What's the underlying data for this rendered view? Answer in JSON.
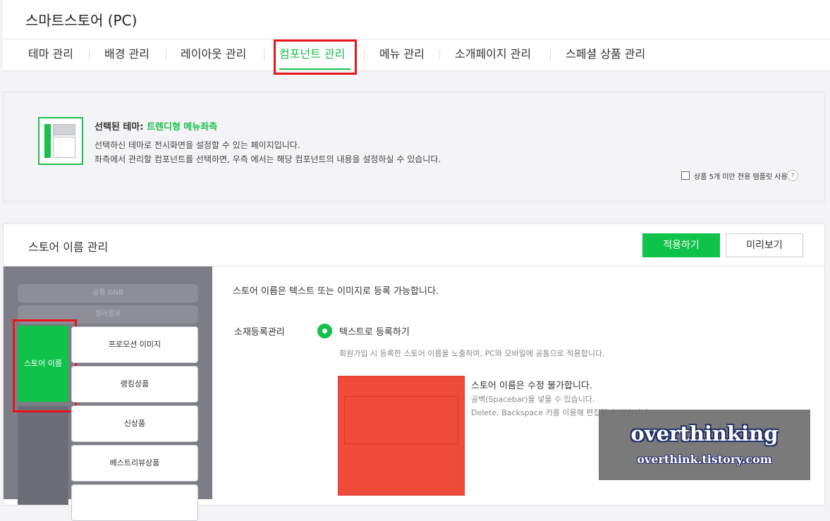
{
  "header": {
    "title": "스마트스토어 (PC)"
  },
  "tabs": [
    {
      "label": "테마 관리",
      "active": false
    },
    {
      "label": "배경 관리",
      "active": false
    },
    {
      "label": "레이아웃 관리",
      "active": false
    },
    {
      "label": "컴포넌트 관리",
      "active": true
    },
    {
      "label": "메뉴 관리",
      "active": false
    },
    {
      "label": "소개페이지 관리",
      "active": false
    },
    {
      "label": "스페셜 상품 관리",
      "active": false
    }
  ],
  "theme": {
    "selected_label": "선택된 테마:",
    "selected_name": "트렌디형 메뉴좌측",
    "desc1": "선택하신 테마로 전시화면을 설정할 수 있는 페이지입니다.",
    "desc2": "좌측에서 관리할 컴포넌트를 선택하면, 우측 에서는 해당 컴포넌트의 내용을 설정하실 수 있습니다.",
    "template_checkbox_label": "상품 5개 미만 전용 템플릿 사용",
    "template_checked": false,
    "help_icon": "?"
  },
  "card": {
    "title": "스토어 이름 관리",
    "apply_label": "적용하기",
    "preview_label": "미리보기"
  },
  "components": {
    "gnb": "공통 GNB",
    "seller_info": "셀러정보",
    "store_name": "스토어 이름",
    "items": [
      "프로모션 이미지",
      "랭킹상품",
      "신상품",
      "베스트리뷰상품"
    ]
  },
  "settings": {
    "intro": "스토어 이름은 텍스트 또는 이미지로 등록 가능합니다.",
    "reg_label": "소재등록관리",
    "radio_label": "텍스트로 등록하기",
    "reg_desc": "회원가입 시 등록한 스토어 이름을 노출하며, PC와 모바일에 공통으로 적용합니다.",
    "edit_title": "스토어 이름은 수정 불가합니다.",
    "edit_note1": "공백(Spacebar)을 넣을 수 있습니다.",
    "edit_note2": "Delete, Backspace 키를 이용해 편집할 수 있습니다."
  },
  "watermark": {
    "main": "overthinking",
    "sub": "overthink.tistory.com"
  },
  "colors": {
    "accent": "#0fc24a",
    "highlight": "#e8161b",
    "redacted": "#ef4b3b"
  }
}
